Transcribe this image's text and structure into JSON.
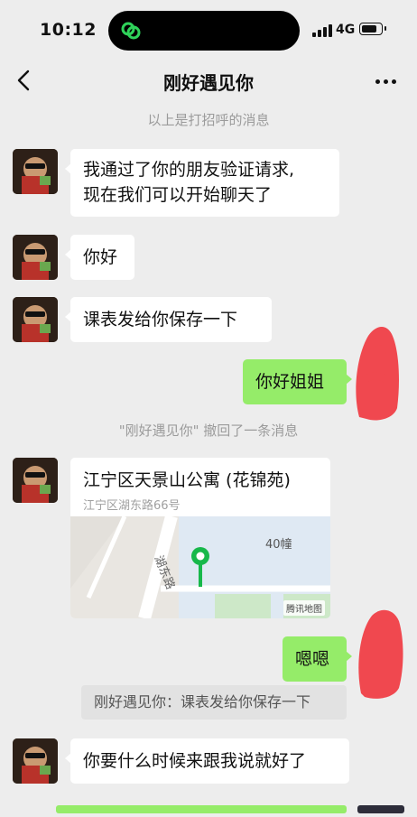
{
  "status": {
    "time": "10:12",
    "network": "4G",
    "battery_level": 0.85
  },
  "nav": {
    "title": "刚好遇见你"
  },
  "system_greeting": "以上是打招呼的消息",
  "recall_notice": "\"刚好遇见你\" 撤回了一条消息",
  "messages": [
    {
      "side": "left",
      "lines": [
        "我通过了你的朋友验证请求,",
        "现在我们可以开始聊天了"
      ]
    },
    {
      "side": "left",
      "lines": [
        "你好"
      ]
    },
    {
      "side": "left",
      "lines": [
        "课表发给你保存一下"
      ]
    },
    {
      "side": "right",
      "lines": [
        "你好姐姐"
      ]
    },
    {
      "side": "right",
      "lines": [
        "嗯嗯"
      ]
    },
    {
      "side": "left",
      "lines": [
        "你要什么时候来跟我说就好了"
      ]
    }
  ],
  "location": {
    "name": "江宁区天景山公寓 (花锦苑)",
    "address": "江宁区湖东路66号",
    "map_building_label": "40幢",
    "map_road_label": "湖东路",
    "map_brand": "腾讯地图"
  },
  "quote": "刚好遇见你：课表发给你保存一下",
  "colors": {
    "background": "#ededed",
    "bubble_self": "#95ec69",
    "bubble_other": "#ffffff",
    "redaction": "#f0484f",
    "map_pin": "#17b84a"
  },
  "icons": {
    "back": "chevron-left-icon",
    "more": "more-dots-icon",
    "app": "link-icon"
  }
}
